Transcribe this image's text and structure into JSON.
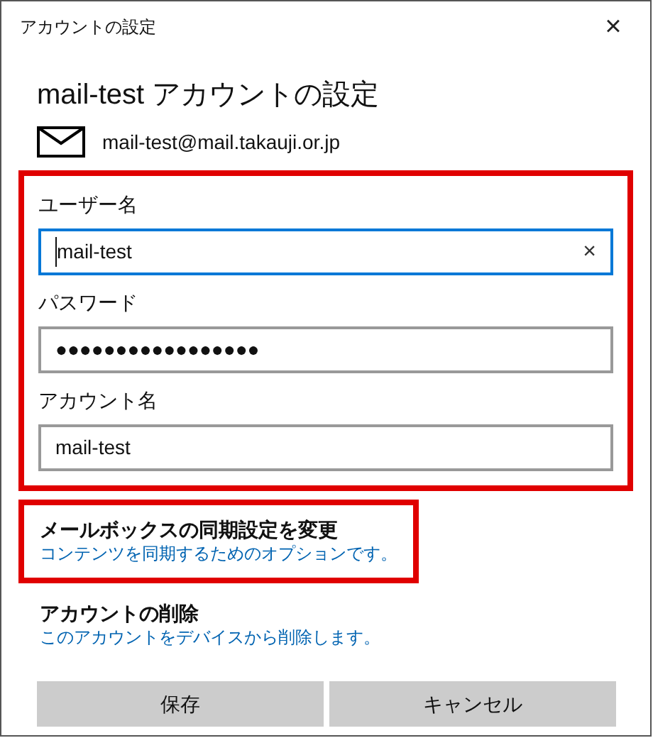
{
  "window": {
    "title": "アカウントの設定",
    "close": "×"
  },
  "heading": "mail-test アカウントの設定",
  "email": "mail-test@mail.takauji.or.jp",
  "fields_highlighted": true,
  "fields": [
    {
      "label": "ユーザー名",
      "value": "mail-test",
      "focused": true,
      "clear": "×"
    },
    {
      "label": "パスワード",
      "value": "●●●●●●●●●●●●●●●●●",
      "focused": false
    },
    {
      "label": "アカウント名",
      "value": "mail-test",
      "focused": false
    }
  ],
  "options": [
    {
      "title": "メールボックスの同期設定を変更",
      "link": "コンテンツを同期するためのオプションです。",
      "highlighted": true
    },
    {
      "title": "アカウントの削除",
      "link": "このアカウントをデバイスから削除します。",
      "highlighted": false
    }
  ],
  "buttons": [
    "保存",
    "キャンセル"
  ]
}
